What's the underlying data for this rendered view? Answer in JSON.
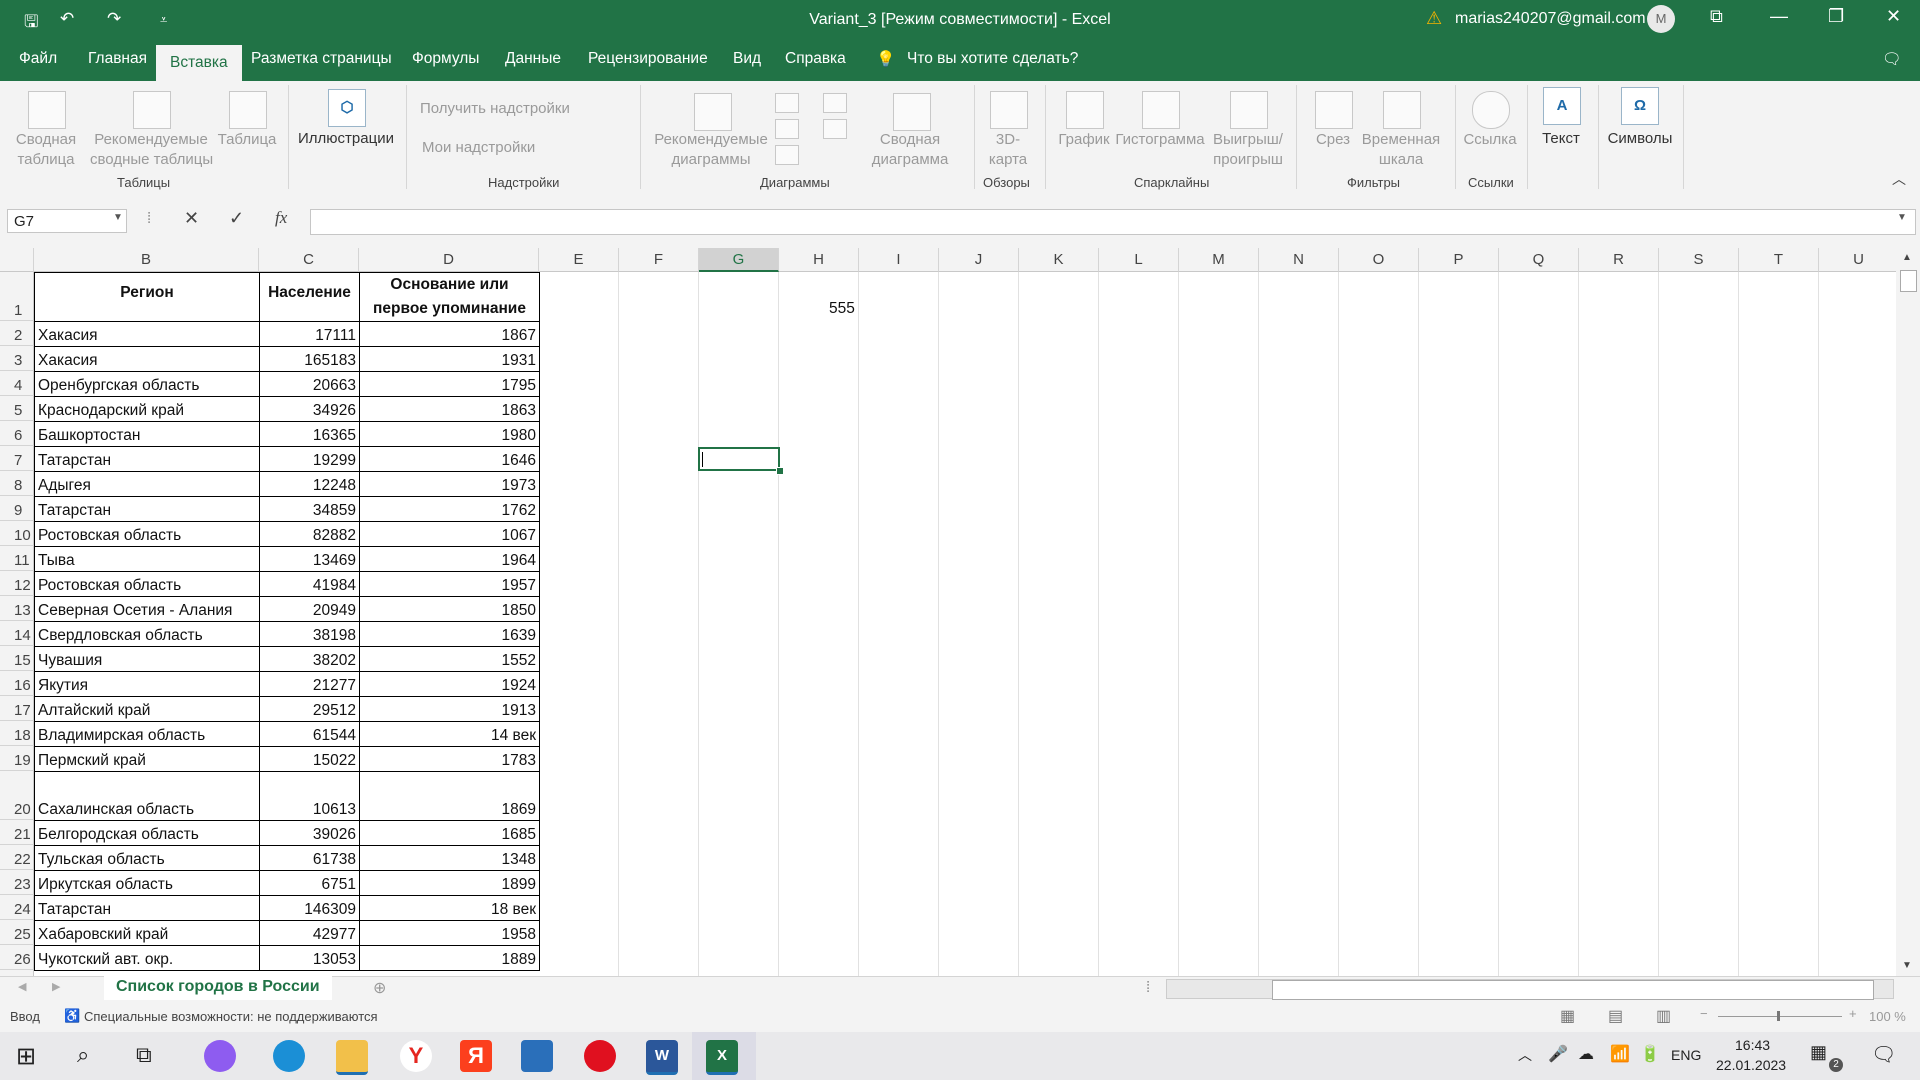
{
  "titlebar": {
    "doc_title": "Variant_3  [Режим совместимости]  -  Excel",
    "account": "marias240207@gmail.com",
    "avatar_letter": "M",
    "qa_save": "🖫",
    "qa_undo": "↶",
    "qa_redo": "↷",
    "qa_more": "⩡"
  },
  "tabs": [
    "Файл",
    "Главная",
    "Вставка",
    "Разметка страницы",
    "Формулы",
    "Данные",
    "Рецензирование",
    "Вид",
    "Справка"
  ],
  "tell_me": "Что вы хотите сделать?",
  "ribbon": {
    "tables": {
      "pivot": "Сводная\nтаблица",
      "rec_pivot": "Рекомендуемые\nсводные таблицы",
      "table": "Таблица",
      "label": "Таблицы"
    },
    "illustrations": "Иллюстрации",
    "addins": {
      "get": "Получить надстройки",
      "my": "Мои надстройки",
      "label": "Надстройки"
    },
    "charts": {
      "rec": "Рекомендуемые\nдиаграммы",
      "pivot_chart": "Сводная\nдиаграмма",
      "label": "Диаграммы"
    },
    "tours": {
      "map3d": "3D-\nкарта",
      "label": "Обзоры"
    },
    "sparklines": {
      "line": "График",
      "column": "Гистограмма",
      "winloss": "Выигрыш/\nпроигрыш",
      "label": "Спарклайны"
    },
    "filters": {
      "slicer": "Срез",
      "timeline": "Временная\nшкала",
      "label": "Фильтры"
    },
    "links": {
      "link": "Ссылка",
      "label": "Ссылки"
    },
    "text": "Текст",
    "symbols": "Символы"
  },
  "formula_bar": {
    "name_box": "G7",
    "fx": "fx",
    "value": ""
  },
  "columns": [
    "B",
    "C",
    "D",
    "E",
    "F",
    "G",
    "H",
    "I",
    "J",
    "K",
    "L",
    "M",
    "N",
    "O",
    "P",
    "Q",
    "R",
    "S",
    "T",
    "U"
  ],
  "table": {
    "headers": [
      "Регион",
      "Население",
      "Основание или первое упоминание"
    ],
    "rows": [
      [
        "2",
        "Хакасия",
        "17111",
        "1867"
      ],
      [
        "3",
        "Хакасия",
        "165183",
        "1931"
      ],
      [
        "4",
        "Оренбургская область",
        "20663",
        "1795"
      ],
      [
        "5",
        "Краснодарский край",
        "34926",
        "1863"
      ],
      [
        "6",
        "Башкортостан",
        "16365",
        "1980"
      ],
      [
        "7",
        "Татарстан",
        "19299",
        "1646"
      ],
      [
        "8",
        "Адыгея",
        "12248",
        "1973"
      ],
      [
        "9",
        "Татарстан",
        "34859",
        "1762"
      ],
      [
        "10",
        "Ростовская область",
        "82882",
        "1067"
      ],
      [
        "11",
        "Тыва",
        "13469",
        "1964"
      ],
      [
        "12",
        "Ростовская область",
        "41984",
        "1957"
      ],
      [
        "13",
        "Северная Осетия - Алания",
        "20949",
        "1850"
      ],
      [
        "14",
        "Свердловская область",
        "38198",
        "1639"
      ],
      [
        "15",
        "Чувашия",
        "38202",
        "1552"
      ],
      [
        "16",
        "Якутия",
        "21277",
        "1924"
      ],
      [
        "17",
        "Алтайский край",
        "29512",
        "1913"
      ],
      [
        "18",
        "Владимирская область",
        "61544",
        "14 век"
      ],
      [
        "19",
        "Пермский край",
        "15022",
        "1783"
      ],
      [
        "20",
        "Сахалинская область",
        "10613",
        "1869"
      ],
      [
        "21",
        "Белгородская область",
        "39026",
        "1685"
      ],
      [
        "22",
        "Тульская область",
        "61738",
        "1348"
      ],
      [
        "23",
        "Иркутская область",
        "6751",
        "1899"
      ],
      [
        "24",
        "Татарстан",
        "146309",
        "18 век"
      ],
      [
        "25",
        "Хабаровский край",
        "42977",
        "1958"
      ],
      [
        "26",
        "Чукотский авт. окр.",
        "13053",
        "1889"
      ]
    ],
    "row1_label": "1"
  },
  "h1_value": "555",
  "sheet_tab": "Список городов в России",
  "status": {
    "mode": "Ввод",
    "accessibility": "Специальные возможности: не поддерживаются",
    "zoom": "100 %"
  },
  "taskbar": {
    "lang": "ENG",
    "time": "16:43",
    "date": "22.01.2023",
    "badge": "2"
  },
  "colors": {
    "excel_green": "#217346",
    "ribbon_bg": "#f3f3f3"
  }
}
